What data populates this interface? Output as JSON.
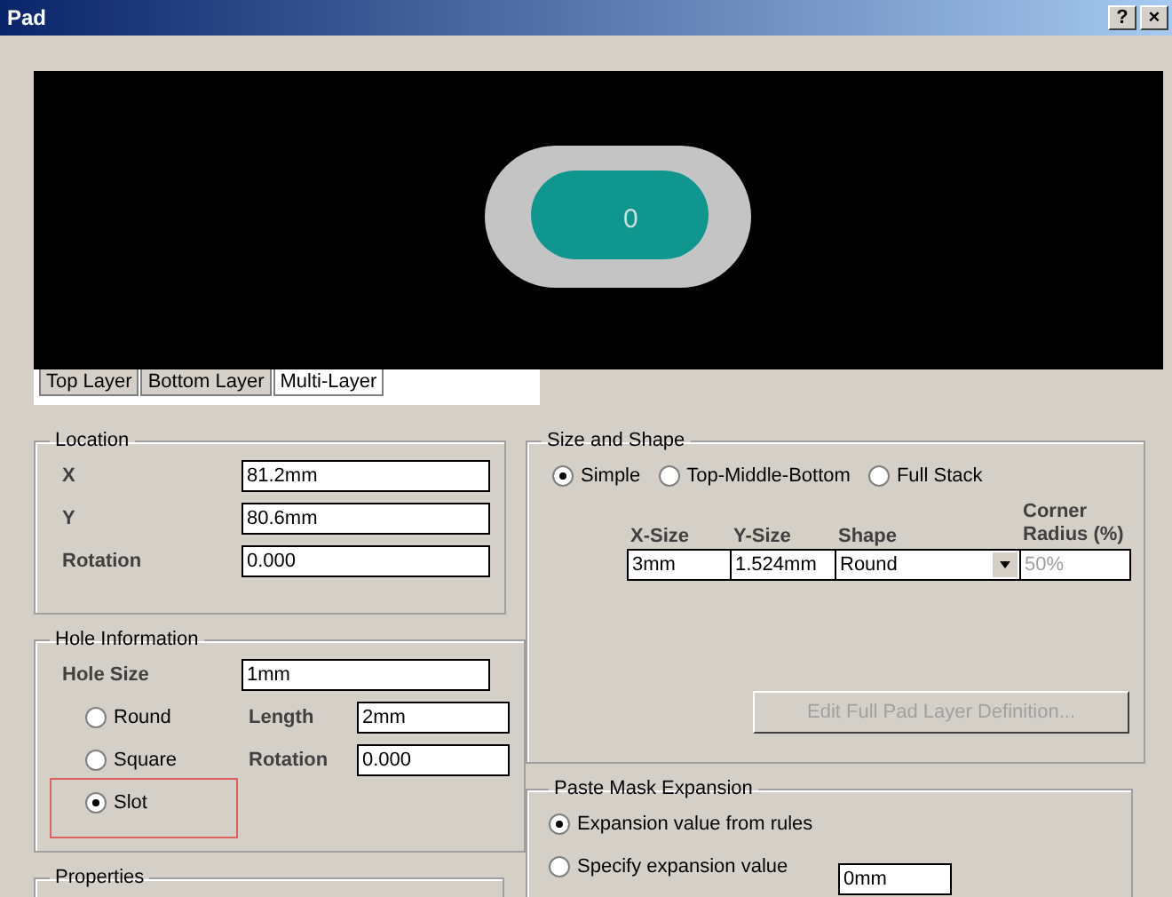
{
  "window": {
    "title": "Pad",
    "help": "?",
    "close": "×"
  },
  "preview": {
    "pad_label": "0",
    "tabs": [
      {
        "label": "Top Layer",
        "selected": false
      },
      {
        "label": "Bottom Layer",
        "selected": false
      },
      {
        "label": "Multi-Layer",
        "selected": true
      }
    ]
  },
  "location": {
    "title": "Location",
    "fields": [
      {
        "label": "X",
        "value": "81.2mm"
      },
      {
        "label": "Y",
        "value": "80.6mm"
      },
      {
        "label": "Rotation",
        "value": "0.000"
      }
    ]
  },
  "hole_information": {
    "title": "Hole Information",
    "hole_size": {
      "label": "Hole Size",
      "value": "1mm"
    },
    "shapes": [
      {
        "label": "Round",
        "selected": false
      },
      {
        "label": "Square",
        "selected": false
      },
      {
        "label": "Slot",
        "selected": true
      }
    ],
    "fields": [
      {
        "label": "Length",
        "value": "2mm"
      },
      {
        "label": "Rotation",
        "value": "0.000"
      }
    ]
  },
  "properties": {
    "title": "Properties"
  },
  "size_and_shape": {
    "title": "Size and Shape",
    "modes": [
      {
        "label": "Simple",
        "selected": true
      },
      {
        "label": "Top-Middle-Bottom",
        "selected": false
      },
      {
        "label": "Full Stack",
        "selected": false
      }
    ],
    "columns": [
      "X-Size",
      "Y-Size",
      "Shape",
      "Corner Radius (%)"
    ],
    "row": {
      "x_size": "3mm",
      "y_size": "1.524mm",
      "shape": "Round",
      "corner_radius": "50%",
      "corner_radius_disabled": true
    },
    "button": {
      "label": "Edit Full Pad Layer Definition...",
      "disabled": true
    }
  },
  "paste_mask_expansion": {
    "title": "Paste Mask Expansion",
    "options": [
      {
        "label": "Expansion value from rules",
        "selected": true
      },
      {
        "label": "Specify expansion value",
        "selected": false
      }
    ],
    "value": "0mm"
  }
}
